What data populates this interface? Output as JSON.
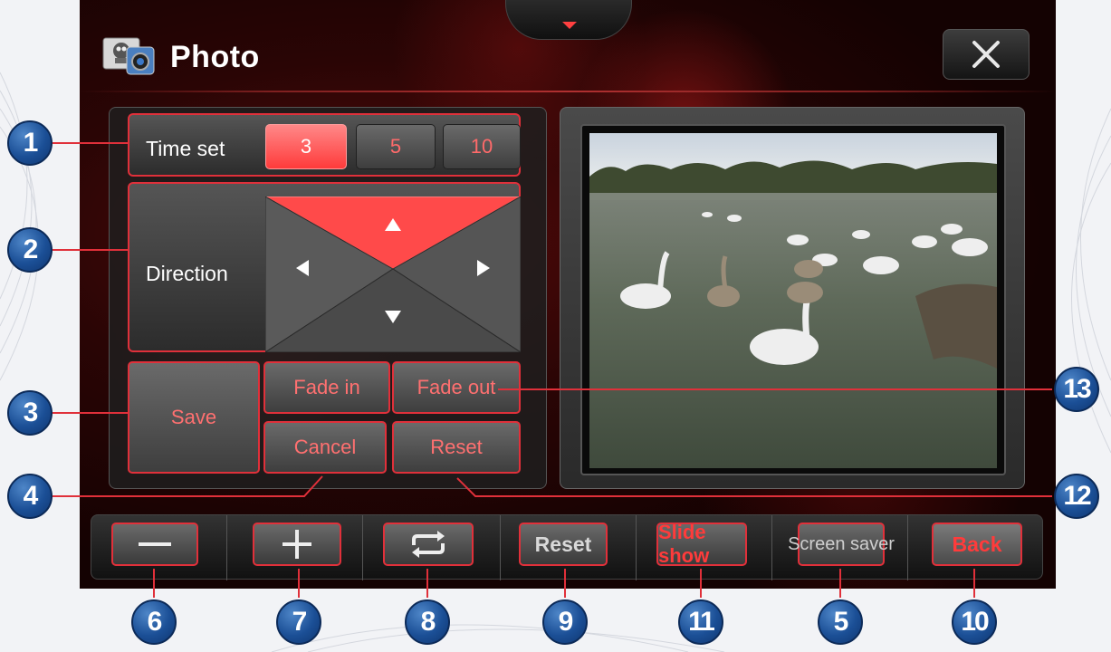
{
  "title_bar": {
    "app_title": "Photo",
    "close_icon": "close-icon",
    "app_icon": "photo-app-icon"
  },
  "time_set": {
    "label": "Time set",
    "options": [
      "3",
      "5",
      "10"
    ],
    "selected": "3"
  },
  "direction": {
    "label": "Direction",
    "selected": "up"
  },
  "effects": {
    "save": "Save",
    "fade_in": "Fade in",
    "fade_out": "Fade out",
    "cancel": "Cancel",
    "reset": "Reset"
  },
  "toolbar": {
    "minus_icon": "minus-icon",
    "plus_icon": "plus-icon",
    "repeat_icon": "repeat-icon",
    "reset": "Reset",
    "slide_show": "Slide show",
    "screen_saver": "Screen saver",
    "back": "Back"
  },
  "callouts": [
    "1",
    "2",
    "3",
    "4",
    "5",
    "6",
    "7",
    "8",
    "9",
    "10",
    "11",
    "12",
    "13"
  ],
  "colors": {
    "accent_red": "#e0303a",
    "active_red": "#ff3b3b",
    "badge_blue": "#1b4f96"
  }
}
